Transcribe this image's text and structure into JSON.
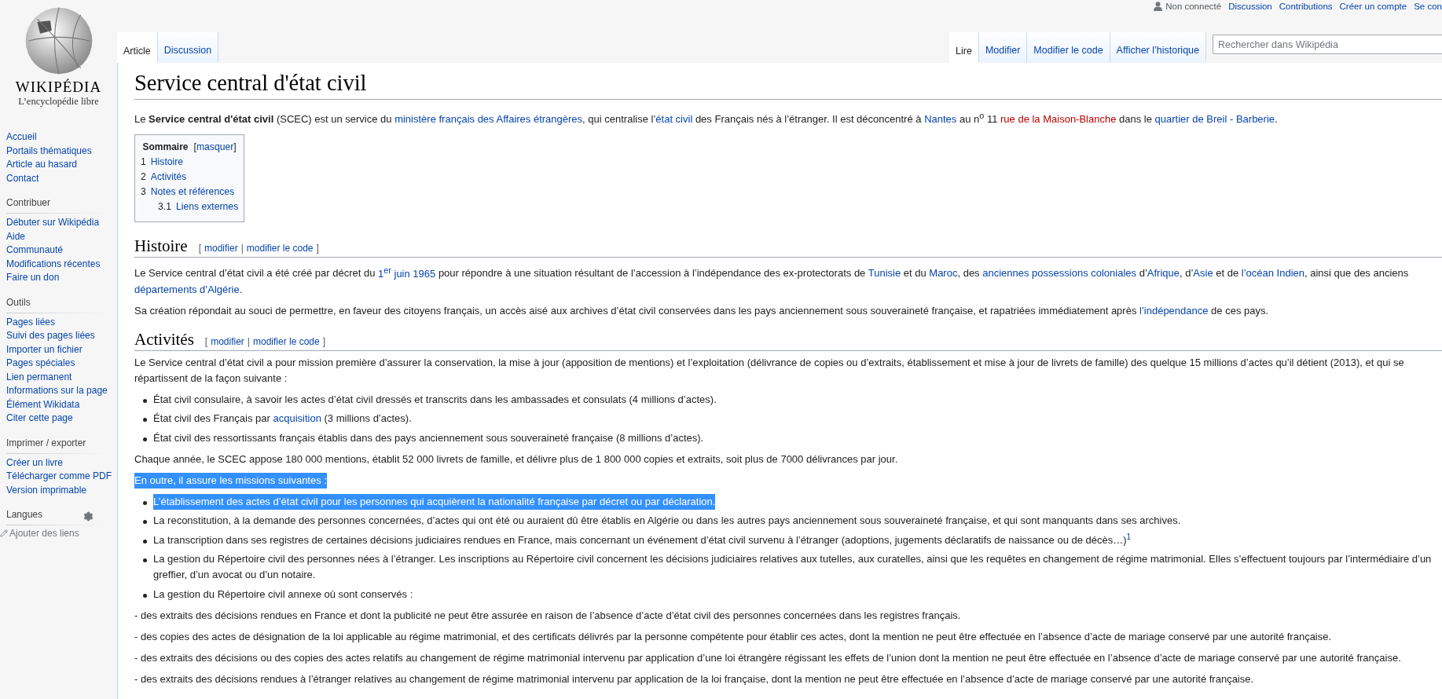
{
  "user_bar": {
    "status": "Non connecté",
    "links": [
      "Discussion",
      "Contributions",
      "Créer un compte",
      "Se con"
    ]
  },
  "logo": {
    "wordmark": "WIKIPÉDIA",
    "tagline": "L’encyclopédie libre"
  },
  "sidebar": {
    "nav": [
      "Accueil",
      "Portails thématiques",
      "Article au hasard",
      "Contact"
    ],
    "portlets": [
      {
        "heading": "Contribuer",
        "items": [
          "Débuter sur Wikipédia",
          "Aide",
          "Communauté",
          "Modifications récentes",
          "Faire un don"
        ]
      },
      {
        "heading": "Outils",
        "items": [
          "Pages liées",
          "Suivi des pages liées",
          "Importer un fichier",
          "Pages spéciales",
          "Lien permanent",
          "Informations sur la page",
          "Élément Wikidata",
          "Citer cette page"
        ]
      },
      {
        "heading": "Imprimer / exporter",
        "items": [
          "Créer un livre",
          "Télécharger comme PDF",
          "Version imprimable"
        ]
      }
    ],
    "languages": {
      "heading": "Langues",
      "add_link": "Ajouter des liens"
    }
  },
  "namespace_tabs": [
    {
      "label": "Article",
      "selected": true
    },
    {
      "label": "Discussion",
      "selected": false
    }
  ],
  "view_tabs": [
    {
      "label": "Lire",
      "selected": true
    },
    {
      "label": "Modifier",
      "selected": false
    },
    {
      "label": "Modifier le code",
      "selected": false
    },
    {
      "label": "Afficher l’historique",
      "selected": false
    }
  ],
  "search": {
    "placeholder": "Rechercher dans Wikipédia"
  },
  "title": "Service central d'état civil",
  "intro": [
    {
      "kind": "text",
      "text": "Le "
    },
    {
      "kind": "bold",
      "text": "Service central d'état civil"
    },
    {
      "kind": "text",
      "text": " (SCEC) est un service du "
    },
    {
      "kind": "link",
      "text": "ministère français des Affaires étrangères"
    },
    {
      "kind": "text",
      "text": ", qui centralise l’"
    },
    {
      "kind": "link",
      "text": "état civil"
    },
    {
      "kind": "text",
      "text": " des Français nés à l’étranger. Il est déconcentré à "
    },
    {
      "kind": "link",
      "text": "Nantes"
    },
    {
      "kind": "text",
      "text": " au n$^{o}$ 11 "
    },
    {
      "kind": "new",
      "text": "rue de la Maison-Blanche"
    },
    {
      "kind": "text",
      "text": " dans le "
    },
    {
      "kind": "link",
      "text": "quartier de Breil - Barberie"
    },
    {
      "kind": "text",
      "text": "."
    }
  ],
  "toc": {
    "title": "Sommaire",
    "toggle": {
      "open": "[",
      "label": "masquer",
      "close": "]"
    },
    "items": [
      {
        "number": "1",
        "label": "Histoire"
      },
      {
        "number": "2",
        "label": "Activités"
      },
      {
        "number": "3",
        "label": "Notes et références",
        "children": [
          {
            "number": "3.1",
            "label": "Liens externes"
          }
        ]
      }
    ]
  },
  "sections": [
    {
      "heading": "Histoire",
      "edit": {
        "open": "[",
        "links": [
          "modifier",
          "modifier le code"
        ],
        "separator": "|",
        "close": "]"
      },
      "blocks": [
        {
          "kind": "para",
          "highlighted": false,
          "segments": [
            {
              "kind": "text",
              "text": "Le Service central d’état civil a été créé par décret du "
            },
            {
              "kind": "link",
              "text": "1$^{er}$ juin 1965"
            },
            {
              "kind": "text",
              "text": " pour répondre à une situation résultant de l’accession à l’indépendance des ex-protectorats de "
            },
            {
              "kind": "link",
              "text": "Tunisie"
            },
            {
              "kind": "text",
              "text": " et du "
            },
            {
              "kind": "link",
              "text": "Maroc"
            },
            {
              "kind": "text",
              "text": ", des "
            },
            {
              "kind": "link",
              "text": "anciennes possessions coloniales"
            },
            {
              "kind": "text",
              "text": " d’"
            },
            {
              "kind": "link",
              "text": "Afrique"
            },
            {
              "kind": "text",
              "text": ", d’"
            },
            {
              "kind": "link",
              "text": "Asie"
            },
            {
              "kind": "text",
              "text": " et de "
            },
            {
              "kind": "link",
              "text": "l’océan Indien"
            },
            {
              "kind": "text",
              "text": ", ainsi que des anciens "
            },
            {
              "kind": "link",
              "text": "départements d’Algérie"
            },
            {
              "kind": "text",
              "text": "."
            }
          ]
        },
        {
          "kind": "para",
          "highlighted": false,
          "segments": [
            {
              "kind": "text",
              "text": "Sa création répondait au souci de permettre, en faveur des citoyens français, un accès aisé aux archives d’état civil conservées dans les pays anciennement sous souveraineté française, et rapatriées immédiatement après "
            },
            {
              "kind": "link",
              "text": "l’indépendance"
            },
            {
              "kind": "text",
              "text": " de ces pays."
            }
          ]
        }
      ]
    },
    {
      "heading": "Activités",
      "edit": {
        "open": "[",
        "links": [
          "modifier",
          "modifier le code"
        ],
        "separator": "|",
        "close": "]"
      },
      "blocks": [
        {
          "kind": "para",
          "highlighted": false,
          "segments": [
            {
              "kind": "text",
              "text": "Le Service central d’état civil a pour mission première d’assurer la conservation, la mise à jour (apposition de mentions) et l’exploitation (délivrance de copies ou d’extraits, établissement et mise à jour de livrets de famille) des quelque 15 millions d’actes qu’il détient (2013), et qui se répartissent de la façon suivante :"
            }
          ]
        },
        {
          "kind": "bullets",
          "items": [
            {
              "highlighted": false,
              "segments": [
                {
                  "kind": "text",
                  "text": "État civil consulaire, à savoir les actes d’état civil dressés et transcrits dans les ambassades et consulats (4 millions d’actes)."
                }
              ]
            },
            {
              "highlighted": false,
              "segments": [
                {
                  "kind": "text",
                  "text": "État civil des Français par "
                },
                {
                  "kind": "link",
                  "text": "acquisition"
                },
                {
                  "kind": "text",
                  "text": " (3 millions d’actes)."
                }
              ]
            },
            {
              "highlighted": false,
              "segments": [
                {
                  "kind": "text",
                  "text": "État civil des ressortissants français établis dans des pays anciennement sous souveraineté française (8 millions d’actes)."
                }
              ]
            }
          ]
        },
        {
          "kind": "para",
          "highlighted": false,
          "segments": [
            {
              "kind": "text",
              "text": "Chaque année, le SCEC appose 180 000 mentions, établit 52 000 livrets de famille, et délivre plus de 1 800 000 copies et extraits, soit plus de 7000 délivrances par jour."
            }
          ]
        },
        {
          "kind": "para",
          "highlighted": true,
          "segments": [
            {
              "kind": "text",
              "text": "En outre, il assure les missions suivantes :"
            }
          ]
        },
        {
          "kind": "bullets",
          "items": [
            {
              "highlighted": true,
              "segments": [
                {
                  "kind": "text",
                  "text": "L’établissement des actes d’état civil pour les personnes qui acquièrent la nationalité française par décret ou par déclaration."
                }
              ]
            },
            {
              "highlighted": false,
              "segments": [
                {
                  "kind": "text",
                  "text": "La reconstitution, à la demande des personnes concernées, d’actes qui ont été ou auraient dû être établis en Algérie ou dans les autres pays anciennement sous souveraineté française, et qui sont manquants dans ses archives."
                }
              ]
            },
            {
              "highlighted": false,
              "segments": [
                {
                  "kind": "text",
                  "text": "La transcription dans ses registres de certaines décisions judiciaires rendues en France, mais concernant un événement d’état civil survenu à l’étranger (adoptions, jugements déclaratifs de naissance ou de décès…)"
                },
                {
                  "kind": "ref",
                  "text": "1"
                }
              ]
            },
            {
              "highlighted": false,
              "segments": [
                {
                  "kind": "text",
                  "text": "La gestion du Répertoire civil des personnes nées à l’étranger. Les inscriptions au Répertoire civil concernent les décisions judiciaires relatives aux tutelles, aux curatelles, ainsi que les requêtes en changement de régime matrimonial. Elles s’effectuent toujours par l’intermédiaire d’un greffier, d’un avocat ou d’un notaire."
                }
              ]
            },
            {
              "highlighted": false,
              "segments": [
                {
                  "kind": "text",
                  "text": "La gestion du Répertoire civil annexe où sont conservés :"
                }
              ]
            }
          ]
        },
        {
          "kind": "para",
          "highlighted": false,
          "segments": [
            {
              "kind": "text",
              "text": "- des extraits des décisions rendues en France et dont la publicité ne peut être assurée en raison de l’absence d’acte d’état civil des personnes concernées dans les registres français."
            }
          ]
        },
        {
          "kind": "para",
          "highlighted": false,
          "segments": [
            {
              "kind": "text",
              "text": "- des copies des actes de désignation de la loi applicable au régime matrimonial, et des certificats délivrés par la personne compétente pour établir ces actes, dont la mention ne peut être effectuée en l’absence d’acte de mariage conservé par une autorité française."
            }
          ]
        },
        {
          "kind": "para",
          "highlighted": false,
          "segments": [
            {
              "kind": "text",
              "text": "- des extraits des décisions ou des copies des actes relatifs au changement de régime matrimonial intervenu par application d’une loi étrangère régissant les effets de l’union dont la mention ne peut être effectuée en l’absence d’acte de mariage conservé par une autorité française."
            }
          ]
        },
        {
          "kind": "para",
          "highlighted": false,
          "segments": [
            {
              "kind": "text",
              "text": "- des extraits des décisions rendues à l’étranger relatives au changement de régime matrimonial intervenu par application de la loi française, dont la mention ne peut être effectuée en l’absence d’acte de mariage conservé par une autorité française."
            }
          ]
        }
      ]
    }
  ]
}
